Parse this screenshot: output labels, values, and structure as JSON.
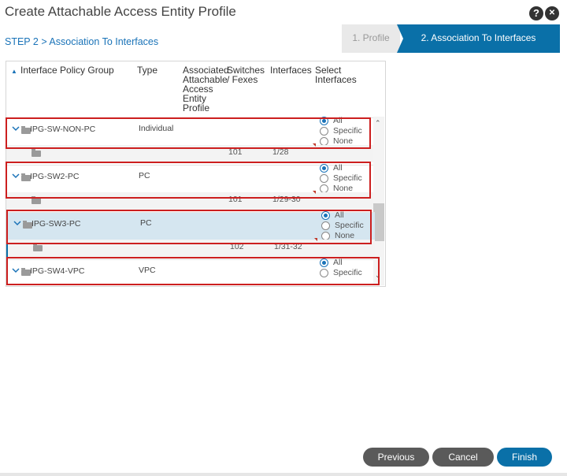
{
  "dialog": {
    "title": "Create Attachable Access Entity Profile"
  },
  "step_label": "STEP 2 > Association To Interfaces",
  "wizard": {
    "steps": [
      {
        "label": "1. Profile",
        "active": false
      },
      {
        "label": "2. Association To Interfaces",
        "active": true
      }
    ]
  },
  "header_icons": {
    "help": "?",
    "close": "✕"
  },
  "table": {
    "columns": {
      "policy_group": "Interface Policy Group",
      "type": "Type",
      "aaep": "Associated Attachable Access Entity Profile",
      "switches": "Switches / Fexes",
      "interfaces": "Interfaces",
      "select": "Select Interfaces"
    },
    "rows": [
      {
        "name": "IPG-SW-NON-PC",
        "type": "Individual",
        "switch": "101",
        "interfaces": "1/28",
        "selected": "All",
        "options": [
          "All",
          "Specific",
          "None"
        ]
      },
      {
        "name": "IPG-SW2-PC",
        "type": "PC",
        "switch": "101",
        "interfaces": "1/29-30",
        "selected": "All",
        "options": [
          "All",
          "Specific",
          "None"
        ]
      },
      {
        "name": "IPG-SW3-PC",
        "type": "PC",
        "switch": "102",
        "interfaces": "1/31-32",
        "selected": "All",
        "options": [
          "All",
          "Specific",
          "None"
        ]
      },
      {
        "name": "IPG-SW4-VPC",
        "type": "VPC",
        "switch": "",
        "interfaces": "",
        "selected": "All",
        "options": [
          "All",
          "Specific"
        ]
      }
    ]
  },
  "buttons": {
    "previous": "Previous",
    "cancel": "Cancel",
    "finish": "Finish"
  },
  "colors": {
    "accent": "#0a70a8",
    "highlight": "#cc1f1f",
    "selected_row": "#d5e6f0"
  }
}
